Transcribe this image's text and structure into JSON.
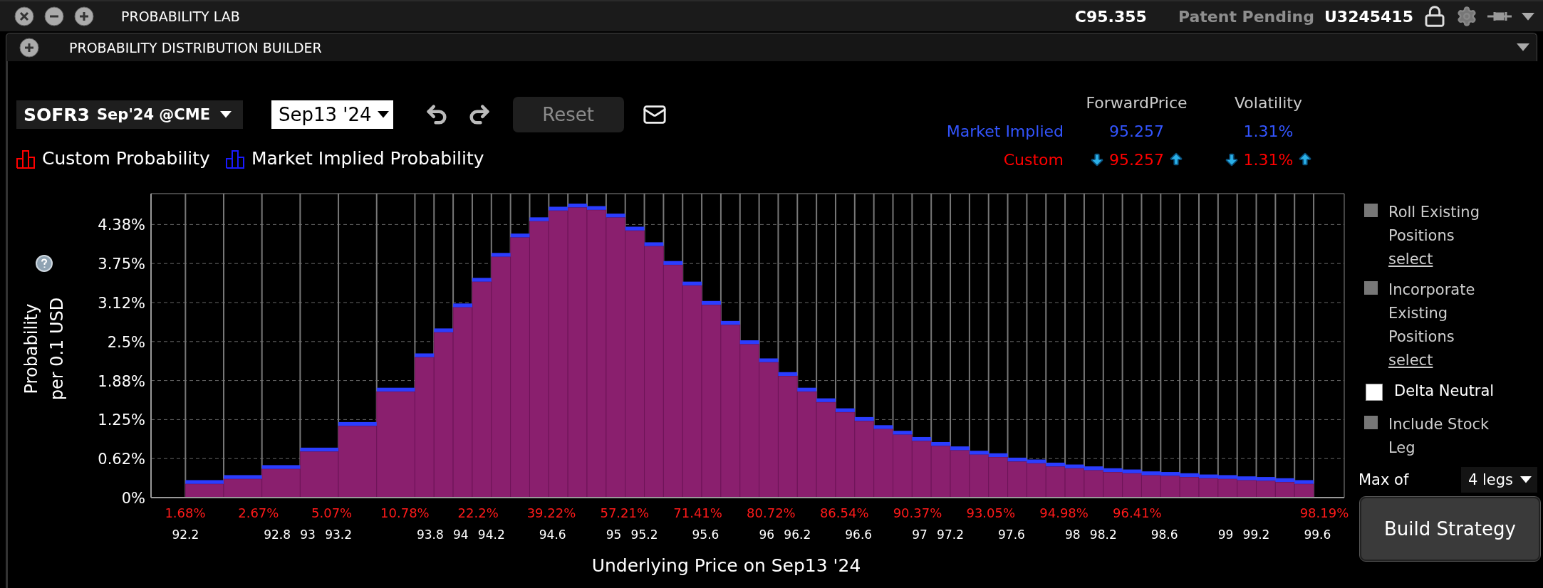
{
  "title_bar": {
    "title": "PROBABILITY LAB",
    "quote": "C95.355",
    "patent": "Patent Pending",
    "account": "U3245415"
  },
  "panel": {
    "title": "PROBABILITY DISTRIBUTION BUILDER"
  },
  "toolbar": {
    "symbol": "SOFR3",
    "contract": "Sep'24 @CME",
    "date": "Sep13 '24",
    "reset": {
      "label": "Reset",
      "disabled": true
    }
  },
  "stats": {
    "columns": [
      "ForwardPrice",
      "Volatility"
    ],
    "rows": [
      {
        "kind": "plain",
        "label": "Market Implied",
        "color": "#3355ff",
        "values": [
          "95.257",
          "1.31%"
        ]
      },
      {
        "kind": "adjustable",
        "label": "Custom",
        "color": "#ff0000",
        "values": [
          "95.257",
          "1.31%"
        ]
      }
    ]
  },
  "chart_data": {
    "type": "bar",
    "stacked": true,
    "xlabel": "Underlying Price on Sep13 '24",
    "ylabel": "Probability per 0.1 USD",
    "xlim": [
      91.975,
      99.775
    ],
    "ylim": [
      0,
      4.87
    ],
    "yticks": [
      {
        "value": 0,
        "label": "0%"
      },
      {
        "value": 0.625,
        "label": "0.62%"
      },
      {
        "value": 1.25,
        "label": "1.25%"
      },
      {
        "value": 1.875,
        "label": "1.88%"
      },
      {
        "value": 2.5,
        "label": "2.5%"
      },
      {
        "value": 3.125,
        "label": "3.12%"
      },
      {
        "value": 3.75,
        "label": "3.75%"
      },
      {
        "value": 4.375,
        "label": "4.38%"
      }
    ],
    "xticks": [
      92.2,
      92.8,
      93,
      93.2,
      93.8,
      94,
      94.2,
      94.6,
      95,
      95.2,
      95.6,
      96,
      96.2,
      96.6,
      97,
      97.2,
      97.6,
      98,
      98.2,
      98.6,
      99,
      99.2,
      99.6
    ],
    "grid": true,
    "annotations": [
      "1.68%",
      "2.67%",
      "5.07%",
      "10.78%",
      "22.2%",
      "39.22%",
      "57.21%",
      "71.41%",
      "80.72%",
      "86.54%",
      "90.37%",
      "93.05%",
      "94.98%",
      "96.41%",
      "98.19%"
    ],
    "x": [
      92.325,
      92.575,
      92.825,
      93.075,
      93.325,
      93.575,
      93.7625,
      93.8875,
      94.0125,
      94.1375,
      94.2625,
      94.3875,
      94.5125,
      94.6375,
      94.7625,
      94.8875,
      95.0125,
      95.1375,
      95.2625,
      95.3875,
      95.5125,
      95.6375,
      95.7625,
      95.8875,
      96.0125,
      96.1375,
      96.2625,
      96.3875,
      96.5125,
      96.6375,
      96.7625,
      96.8875,
      97.0125,
      97.1375,
      97.2625,
      97.3875,
      97.5125,
      97.6375,
      97.7625,
      97.8875,
      98.0125,
      98.1375,
      98.2625,
      98.3875,
      98.5125,
      98.6375,
      98.7625,
      98.8875,
      99.0125,
      99.1375,
      99.2625,
      99.3875,
      99.5125
    ],
    "series": [
      {
        "name": "Custom Probability",
        "color": "#8a1f6e",
        "values": [
          0.22,
          0.3,
          0.46,
          0.74,
          1.15,
          1.7,
          2.25,
          2.65,
          3.05,
          3.46,
          3.86,
          4.17,
          4.43,
          4.6,
          4.65,
          4.61,
          4.49,
          4.28,
          4.03,
          3.73,
          3.4,
          3.09,
          2.77,
          2.46,
          2.17,
          1.95,
          1.7,
          1.53,
          1.37,
          1.23,
          1.1,
          1.01,
          0.91,
          0.83,
          0.76,
          0.69,
          0.65,
          0.58,
          0.55,
          0.5,
          0.47,
          0.44,
          0.41,
          0.39,
          0.36,
          0.35,
          0.33,
          0.31,
          0.3,
          0.28,
          0.27,
          0.25,
          0.22
        ]
      },
      {
        "name": "Market Implied Probability",
        "color": "#2b3dff",
        "values": [
          0.06,
          0.06,
          0.06,
          0.06,
          0.06,
          0.06,
          0.06,
          0.06,
          0.06,
          0.06,
          0.06,
          0.06,
          0.06,
          0.06,
          0.06,
          0.06,
          0.06,
          0.06,
          0.06,
          0.06,
          0.06,
          0.06,
          0.06,
          0.06,
          0.06,
          0.06,
          0.06,
          0.06,
          0.06,
          0.06,
          0.06,
          0.06,
          0.06,
          0.06,
          0.06,
          0.06,
          0.06,
          0.06,
          0.06,
          0.06,
          0.06,
          0.06,
          0.06,
          0.06,
          0.06,
          0.06,
          0.06,
          0.06,
          0.06,
          0.06,
          0.06,
          0.06,
          0.06
        ]
      }
    ]
  },
  "legend": [
    {
      "color": "#ff0000"
    },
    {
      "color": "#1a1aff"
    }
  ],
  "options": [
    {
      "kind": "checkbox",
      "label": "Roll Existing Positions",
      "checked": false,
      "disabled": true,
      "link": "select"
    },
    {
      "kind": "checkbox",
      "label": "Incorporate Existing Positions",
      "checked": false,
      "disabled": true,
      "link": "select"
    },
    {
      "kind": "checkbox",
      "label": "Delta Neutral",
      "checked": false,
      "disabled": false
    },
    {
      "kind": "checkbox",
      "label": "Include Stock Leg",
      "checked": false,
      "disabled": true
    }
  ],
  "max_legs": {
    "label": "Max of",
    "value": "4 legs"
  },
  "build_button": "Build Strategy"
}
